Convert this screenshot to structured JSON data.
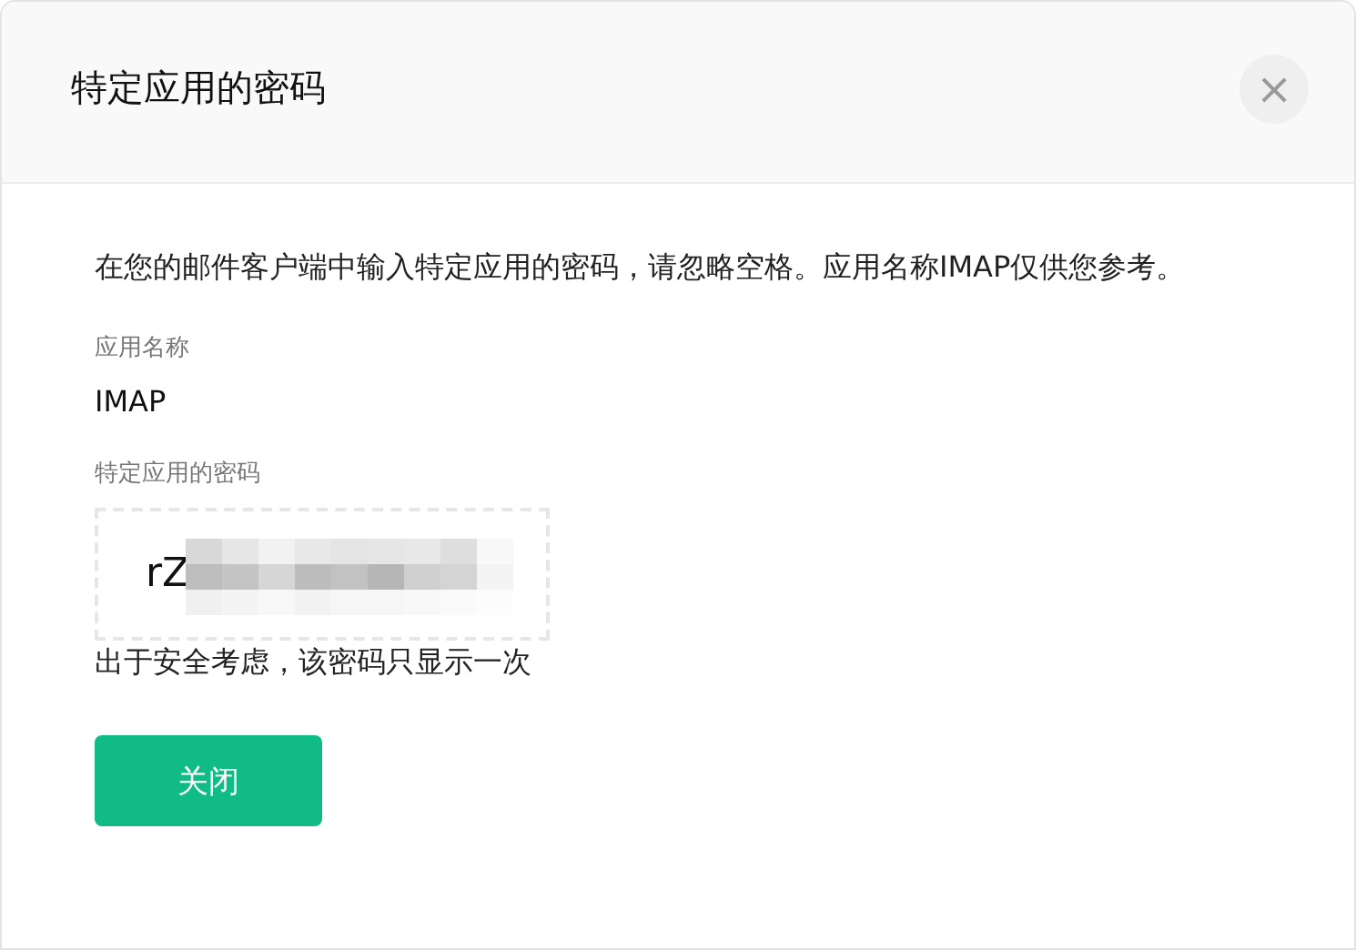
{
  "dialog": {
    "title": "特定应用的密码",
    "close": "×"
  },
  "description": "在您的邮件客户端中输入特定应用的密码，请忽略空格。应用名称IMAP仅供您参考。",
  "fields": [
    {
      "label": "应用名称",
      "value": "IMAP"
    },
    {
      "label": "特定应用的密码",
      "value": "rZ",
      "kind": "password"
    }
  ],
  "note": "出于安全考虑，该密码只显示一次",
  "buttons": [
    "关闭"
  ]
}
